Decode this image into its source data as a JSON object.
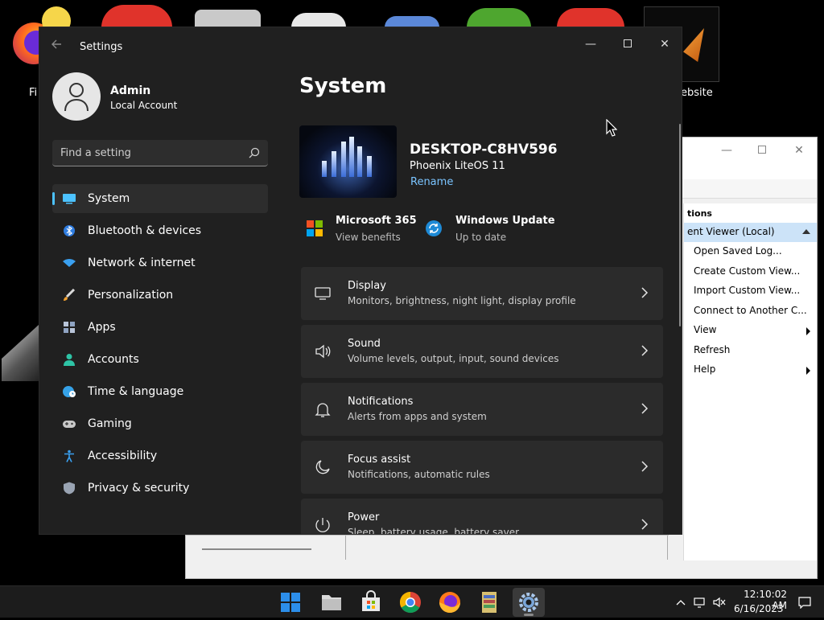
{
  "desktop": {
    "icons": [
      {
        "label": "Fi"
      },
      {
        "label": "ebsite"
      }
    ]
  },
  "event_viewer": {
    "actions_header": "tions",
    "selected": "ent Viewer (Local)",
    "items": [
      "Open Saved Log...",
      "Create Custom View...",
      "Import Custom View...",
      "Connect to Another C...",
      "View",
      "Refresh",
      "Help"
    ],
    "controls": {
      "minimize": "—",
      "close": "✕"
    }
  },
  "settings": {
    "window_title": "Settings",
    "controls": {
      "minimize": "—",
      "close": "✕"
    },
    "user": {
      "name": "Admin",
      "account_type": "Local Account"
    },
    "search": {
      "placeholder": "Find a setting"
    },
    "nav": [
      {
        "label": "System",
        "icon": "display-icon"
      },
      {
        "label": "Bluetooth & devices",
        "icon": "bluetooth-icon"
      },
      {
        "label": "Network & internet",
        "icon": "wifi-icon"
      },
      {
        "label": "Personalization",
        "icon": "brush-icon"
      },
      {
        "label": "Apps",
        "icon": "apps-icon"
      },
      {
        "label": "Accounts",
        "icon": "person-icon"
      },
      {
        "label": "Time & language",
        "icon": "globe-clock-icon"
      },
      {
        "label": "Gaming",
        "icon": "controller-icon"
      },
      {
        "label": "Accessibility",
        "icon": "accessibility-icon"
      },
      {
        "label": "Privacy & security",
        "icon": "shield-icon"
      }
    ],
    "page_title": "System",
    "device": {
      "name": "DESKTOP-C8HV596",
      "os": "Phoenix LiteOS 11",
      "rename_label": "Rename"
    },
    "quick": [
      {
        "title": "Microsoft 365",
        "subtitle": "View benefits"
      },
      {
        "title": "Windows Update",
        "subtitle": "Up to date"
      }
    ],
    "cards": [
      {
        "title": "Display",
        "description": "Monitors, brightness, night light, display profile",
        "icon": "monitor-icon"
      },
      {
        "title": "Sound",
        "description": "Volume levels, output, input, sound devices",
        "icon": "speaker-icon"
      },
      {
        "title": "Notifications",
        "description": "Alerts from apps and system",
        "icon": "bell-icon"
      },
      {
        "title": "Focus assist",
        "description": "Notifications, automatic rules",
        "icon": "moon-icon"
      },
      {
        "title": "Power",
        "description": "Sleep, battery usage, battery saver",
        "icon": "power-icon"
      }
    ]
  },
  "taskbar": {
    "apps": [
      "start-icon",
      "file-explorer-icon",
      "store-icon",
      "chrome-icon",
      "firefox-icon",
      "archive-icon",
      "settings-icon"
    ],
    "clock": {
      "time": "12:10:02 AM",
      "date": "6/16/2023"
    }
  },
  "colors": {
    "accent": "#4cc2ff",
    "link": "#7ac4ff",
    "window_bg": "#202020",
    "card_bg": "#2b2b2b"
  }
}
